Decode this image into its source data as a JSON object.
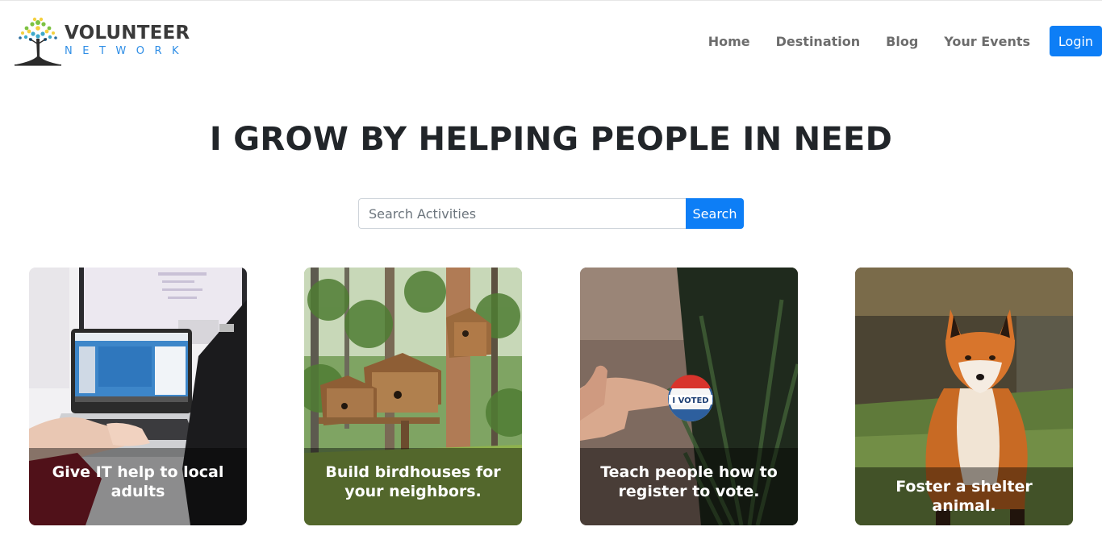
{
  "brand": {
    "name": "VOLUNTEER",
    "subname": "NETWORK"
  },
  "nav": {
    "items": [
      "Home",
      "Destination",
      "Blog",
      "Your Events"
    ],
    "login_label": "Login"
  },
  "hero": {
    "title": "I GROW BY HELPING PEOPLE IN NEED"
  },
  "search": {
    "placeholder": "Search Activities",
    "value": "",
    "button_label": "Search"
  },
  "cards": [
    {
      "title": "Give IT help to local adults"
    },
    {
      "title": "Build birdhouses for your neighbors."
    },
    {
      "title": "Teach people how to register to vote."
    },
    {
      "title": "Foster a shelter animal."
    }
  ],
  "badge_text": "I VOTED",
  "colors": {
    "primary": "#0d7ef6",
    "brand_blue": "#2f8ee6",
    "nav_text": "#6c6c6c",
    "heading": "#212529"
  }
}
